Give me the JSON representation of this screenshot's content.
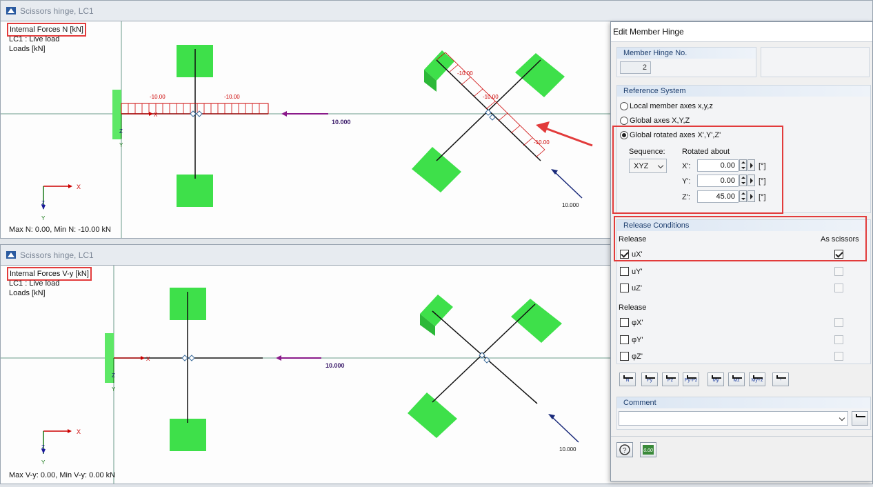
{
  "top_window": {
    "title": "Scissors hinge, LC1",
    "info_line1": "Internal Forces N [kN]",
    "info_line2": "LC1 : Live load",
    "info_line3": "Loads [kN]",
    "maxmin": "Max N: 0.00, Min N: -10.00 kN",
    "labels": {
      "n_left1": "-10.00",
      "n_left2": "-10.00",
      "n_diag1": "-10.00",
      "n_diag2": "-10.00",
      "n_diag3": "-10.00",
      "load1": "10.000",
      "load2": "10.000"
    }
  },
  "bottom_window": {
    "title": "Scissors hinge, LC1",
    "info_line1": "Internal Forces V-y [kN]",
    "info_line2": "LC1 : Live load",
    "info_line3": "Loads [kN]",
    "maxmin": "Max V-y: 0.00, Min V-y: 0.00 kN",
    "labels": {
      "load1": "10.000",
      "load2": "10.000"
    }
  },
  "axes": {
    "x": "X",
    "y": "Y",
    "z": "Z"
  },
  "dialog": {
    "title": "Edit Member Hinge",
    "hinge_no": {
      "header": "Member Hinge No.",
      "value": "2"
    },
    "reference_system": {
      "header": "Reference System",
      "options": [
        "Local member axes x,y,z",
        "Global axes X,Y,Z",
        "Global rotated axes X',Y',Z'"
      ],
      "selected": "Global rotated axes X',Y',Z'",
      "sequence_label": "Sequence:",
      "sequence_value": "XYZ",
      "rotated_about_label": "Rotated about",
      "rotations": [
        {
          "axis": "X':",
          "value": "0.00",
          "unit": "[°]"
        },
        {
          "axis": "Y':",
          "value": "0.00",
          "unit": "[°]"
        },
        {
          "axis": "Z':",
          "value": "45.00",
          "unit": "[°]"
        }
      ]
    },
    "release_conditions": {
      "header": "Release Conditions",
      "release_label": "Release",
      "as_scissors_label": "As scissors",
      "translations": [
        {
          "label": "uX'",
          "checked": true,
          "scissors": true
        },
        {
          "label": "uY'",
          "checked": false,
          "scissors": false
        },
        {
          "label": "uZ'",
          "checked": false,
          "scissors": false
        }
      ],
      "release_label2": "Release",
      "rotations": [
        {
          "label": "φX'",
          "checked": false,
          "scissors": false
        },
        {
          "label": "φY'",
          "checked": false,
          "scissors": false
        },
        {
          "label": "φZ'",
          "checked": false,
          "scissors": false
        }
      ]
    },
    "toolbar_buttons": [
      "N",
      "Py",
      "Pz",
      "Py-Pz",
      "My",
      "Mz",
      "My+z",
      "-"
    ],
    "comment": {
      "header": "Comment",
      "value": ""
    },
    "footer_value_button": "0.00"
  },
  "colors": {
    "accent_red": "#e23b3b",
    "support_green": "#3ee04a",
    "force_red": "#cc0000",
    "load_purple": "#8a1a8a",
    "load_navy": "#1a2a7a"
  }
}
